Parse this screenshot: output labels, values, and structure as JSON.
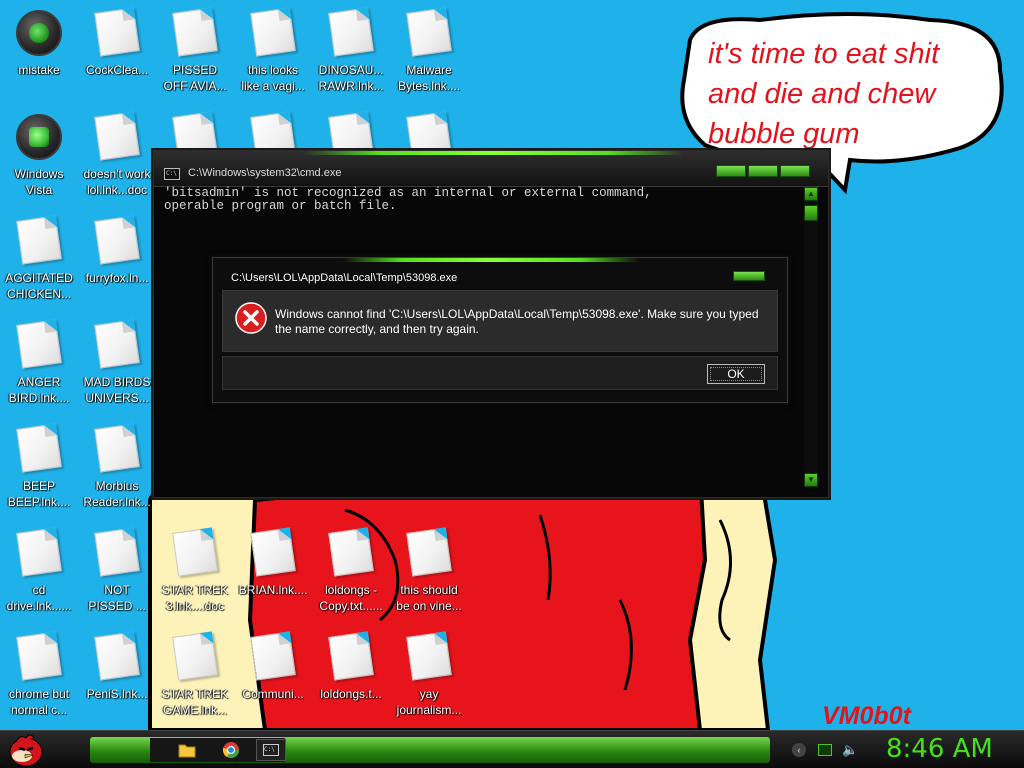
{
  "wallpaper": {
    "speech_bubble": "it's time to eat shit\nand die and chew\nbubble gum",
    "signature": "VM0b0t"
  },
  "desktop_icons": [
    {
      "label": "mistake",
      "type": "sphere"
    },
    {
      "label": "CockClea...",
      "type": "doc"
    },
    {
      "label": "PISSED\nOFF AVIA...",
      "type": "doc"
    },
    {
      "label": "this looks\nlike a vagi...",
      "type": "doc"
    },
    {
      "label": "DINOSAU...\nRAWR.lnk...",
      "type": "doc"
    },
    {
      "label": "Malware\nBytes.lnk....",
      "type": "doc"
    },
    {
      "label": "Windows\nVista",
      "type": "recycle"
    },
    {
      "label": "doesn't work\nlol.lnk...doc",
      "type": "doc"
    },
    {
      "label": "",
      "type": "doc"
    },
    {
      "label": "",
      "type": "doc"
    },
    {
      "label": "",
      "type": "doc"
    },
    {
      "label": "",
      "type": "doc"
    },
    {
      "label": "AGGITATED\nCHICKEN...",
      "type": "doc"
    },
    {
      "label": "furryfox.ln...",
      "type": "doc"
    },
    {
      "label": "ANGER\nBIRD.lnk....",
      "type": "doc"
    },
    {
      "label": "MAD BIRDS\nUNIVERS...",
      "type": "doc"
    },
    {
      "label": "BEEP\nBEEP.lnk....",
      "type": "doc"
    },
    {
      "label": "Morbius\nReader.lnk...",
      "type": "doc"
    },
    {
      "label": "cd\ndrive.lnk......",
      "type": "doc"
    },
    {
      "label": "NOT\nPISSED ...",
      "type": "doc"
    },
    {
      "label": "STAR TREK\n3.lnk....doc",
      "type": "doc"
    },
    {
      "label": "BRIAN.lnk....",
      "type": "doc"
    },
    {
      "label": "loldongs -\nCopy.txt......",
      "type": "doc"
    },
    {
      "label": "this should\nbe on vine...",
      "type": "doc"
    },
    {
      "label": "chrome but\nnormal c...",
      "type": "doc"
    },
    {
      "label": "PeniS.lnk...",
      "type": "doc"
    },
    {
      "label": "STAR TREK\nGAME.lnk...",
      "type": "doc"
    },
    {
      "label": "Communi...",
      "type": "doc"
    },
    {
      "label": "loldongs.t...",
      "type": "doc"
    },
    {
      "label": "yay\njournalism...",
      "type": "doc"
    }
  ],
  "cmd_window": {
    "title": "C:\\Windows\\system32\\cmd.exe",
    "icon": "console-icon",
    "output": "'bitsadmin' is not recognized as an internal or external command,\noperable program or batch file."
  },
  "error_dialog": {
    "title": "C:\\Users\\LOL\\AppData\\Local\\Temp\\53098.exe",
    "icon": "error-icon",
    "message": "Windows cannot find 'C:\\Users\\LOL\\AppData\\Local\\Temp\\53098.exe'. Make sure you typed the name correctly, and then try again.",
    "ok_label": "OK"
  },
  "taskbar": {
    "start_icon": "angry-bird-icon",
    "pinned": [
      "folder-icon",
      "chrome-icon",
      "console-icon"
    ],
    "clock": "8:46 AM",
    "accent": "#45e01a"
  }
}
